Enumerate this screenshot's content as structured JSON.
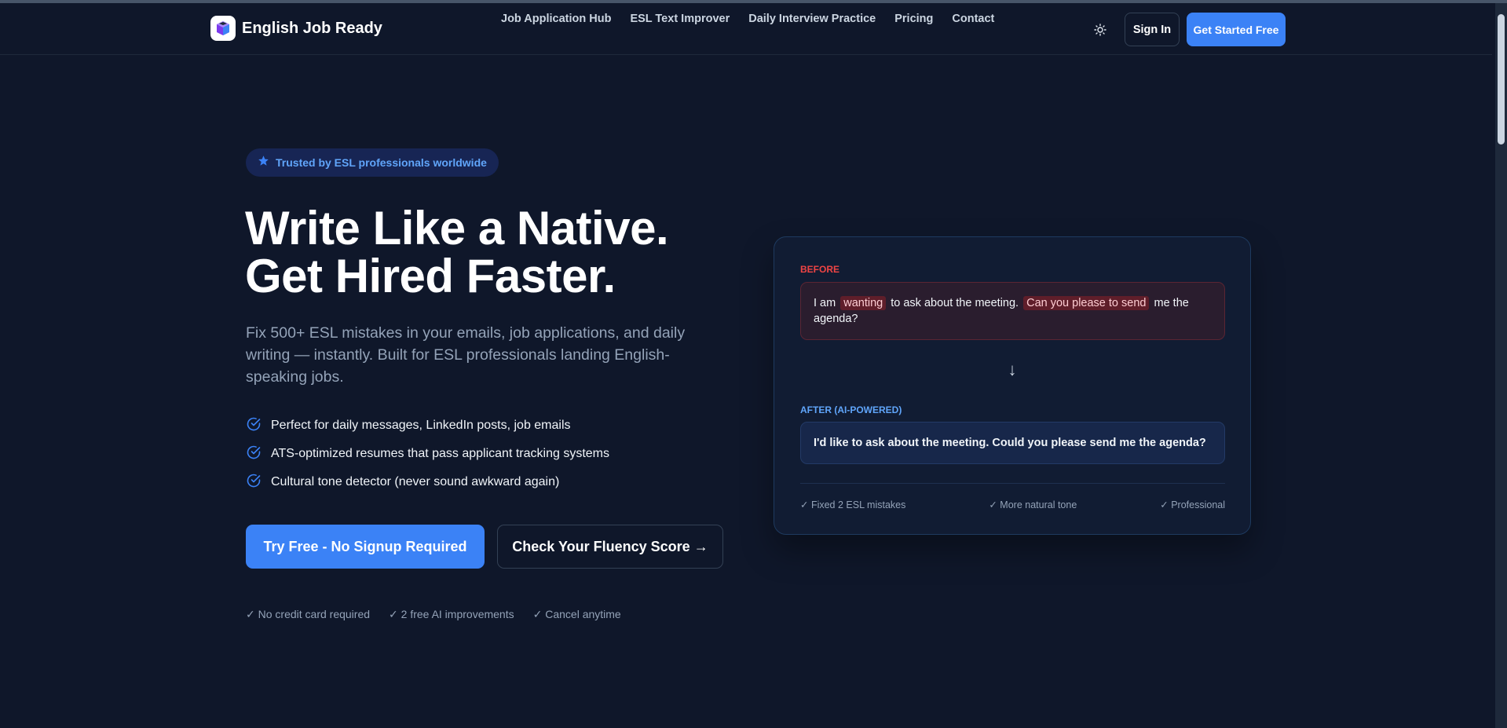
{
  "brand": {
    "name": "English Job Ready",
    "logo_icon": "graduation-cube-icon"
  },
  "nav": {
    "links": [
      "Job Application Hub",
      "ESL Text Improver",
      "Daily Interview Practice",
      "Pricing",
      "Contact"
    ],
    "theme_icon": "sun-icon",
    "signin_label": "Sign In",
    "cta_label": "Get Started Free"
  },
  "hero": {
    "badge": "Trusted by ESL professionals worldwide",
    "badge_icon": "star-icon",
    "headline": "Write Like a Native. Get Hired Faster.",
    "subtitle": "Fix 500+ ESL mistakes in your emails, job applications, and daily writing — instantly. Built for ESL professionals landing English-speaking jobs.",
    "features": [
      "Perfect for daily messages, LinkedIn posts, job emails",
      "ATS-optimized resumes that pass applicant tracking systems",
      "Cultural tone detector (never sound awkward again)"
    ],
    "primary_cta": "Try Free - No Signup Required",
    "secondary_cta": "Check Your Fluency Score →",
    "trust": [
      "✓ No credit card required",
      "✓ 2 free AI improvements",
      "✓ Cancel anytime"
    ]
  },
  "demo": {
    "before_label": "BEFORE",
    "before_parts": {
      "p1": "I am",
      "hl1": "wanting",
      "p2": "to ask about the meeting.",
      "hl2": "Can you please to send",
      "p3": "me the agenda?"
    },
    "arrow": "↓",
    "after_label": "AFTER (AI-POWERED)",
    "after_text": "I'd like to ask about the meeting. Could you please send me the agenda?",
    "footer": [
      "✓ Fixed 2 ESL mistakes",
      "✓ More natural tone",
      "✓ Professional"
    ]
  },
  "colors": {
    "background": "#0f172a",
    "accent": "#3b82f6",
    "before_red": "#ef4444",
    "after_blue": "#60a5fa"
  }
}
